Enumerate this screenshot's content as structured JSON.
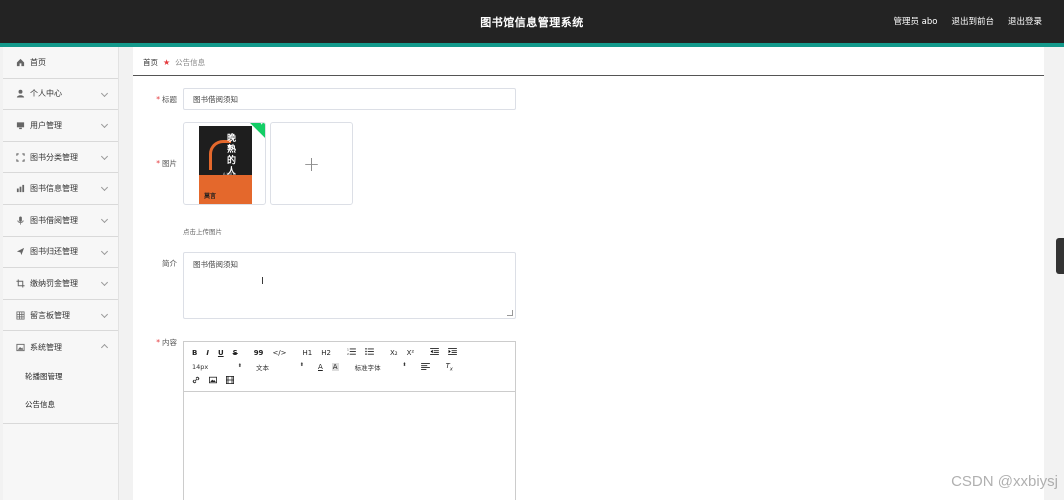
{
  "header": {
    "title": "图书馆信息管理系统",
    "user_label": "管理员 abo",
    "front_link": "退出到前台",
    "logout_link": "退出登录"
  },
  "sidebar": {
    "items": [
      {
        "label": "首页",
        "icon": "home-icon"
      },
      {
        "label": "个人中心",
        "icon": "user-icon"
      },
      {
        "label": "用户管理",
        "icon": "monitor-icon"
      },
      {
        "label": "图书分类管理",
        "icon": "scan-icon"
      },
      {
        "label": "图书信息管理",
        "icon": "chart-icon"
      },
      {
        "label": "图书借阅管理",
        "icon": "mic-icon"
      },
      {
        "label": "图书归还管理",
        "icon": "send-icon"
      },
      {
        "label": "缴纳罚金管理",
        "icon": "crop-icon"
      },
      {
        "label": "留言板管理",
        "icon": "grid-icon"
      },
      {
        "label": "系统管理",
        "icon": "image-icon"
      }
    ],
    "sub_items": [
      "轮播图管理",
      "公告信息"
    ]
  },
  "breadcrumb": {
    "home": "首页",
    "current": "公告信息"
  },
  "form": {
    "title_label": "标题",
    "title_value": "图书借阅须知",
    "image_label": "图片",
    "upload_hint": "点击上传图片",
    "summary_label": "简介",
    "summary_value": "图书借阅须知",
    "content_label": "内容"
  },
  "book_cover": {
    "title_text": "晚熟的人",
    "english": "A LATE BLOOMER",
    "author": "莫言"
  },
  "editor": {
    "row1": [
      "B",
      "I",
      "U",
      "S",
      "99",
      "</>",
      "H1",
      "H2",
      "OL",
      "UL",
      "X₂",
      "X²",
      "Indent-",
      "Indent+"
    ],
    "font_size": "14px",
    "text_type": "文本",
    "font_family": "标准字体"
  },
  "watermark": "CSDN @xxbiysj",
  "colors": {
    "topbar": "#232323",
    "accent": "#13998b",
    "required": "#e4393c"
  }
}
